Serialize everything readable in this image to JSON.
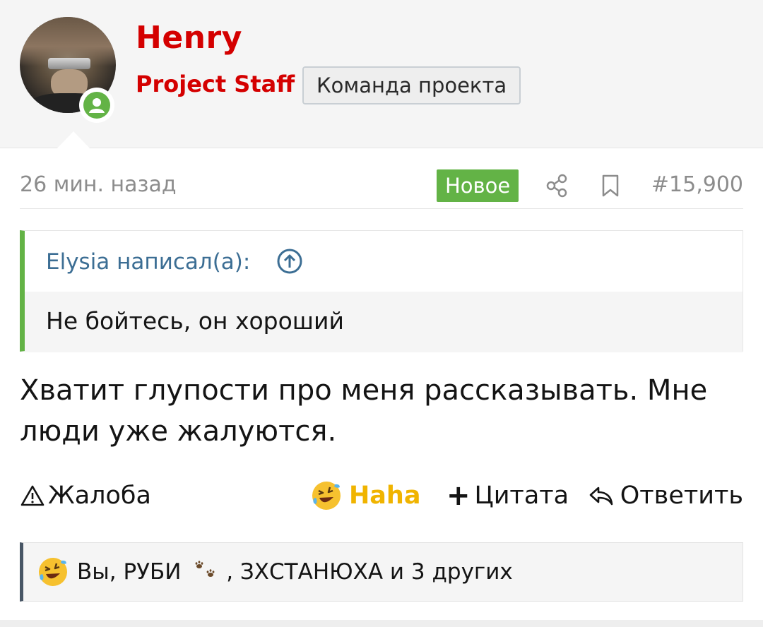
{
  "author": {
    "name": "Henry",
    "title": "Project Staff",
    "banner": "Команда проекта",
    "online": true
  },
  "post": {
    "time": "26 мин. назад",
    "new_badge": "Новое",
    "number": "#15,900",
    "quote": {
      "author": "Elysia написал(а):",
      "text": "Не бойтесь, он хороший"
    },
    "message": "Хватит глупости про меня рассказывать. Мне люди уже жалуются."
  },
  "actions": {
    "report": "Жалоба",
    "reaction": "Haha",
    "quote": "Цитата",
    "reply": "Ответить"
  },
  "reactions": {
    "users_before": "Вы, РУБИ",
    "users_after": ", ЗХСТАНЮХА и 3 других"
  },
  "colors": {
    "username": "#d40000",
    "online": "#63b346",
    "new_badge": "#63b346",
    "quote_border": "#63b346",
    "quote_author": "#3c6e94",
    "reaction": "#f0b400"
  },
  "icons": [
    "user-icon",
    "share-icon",
    "bookmark-icon",
    "arrow-up-circle-icon",
    "warning-icon",
    "laughing-emoji-icon",
    "plus-icon",
    "reply-icon",
    "paw-prints-icon"
  ]
}
